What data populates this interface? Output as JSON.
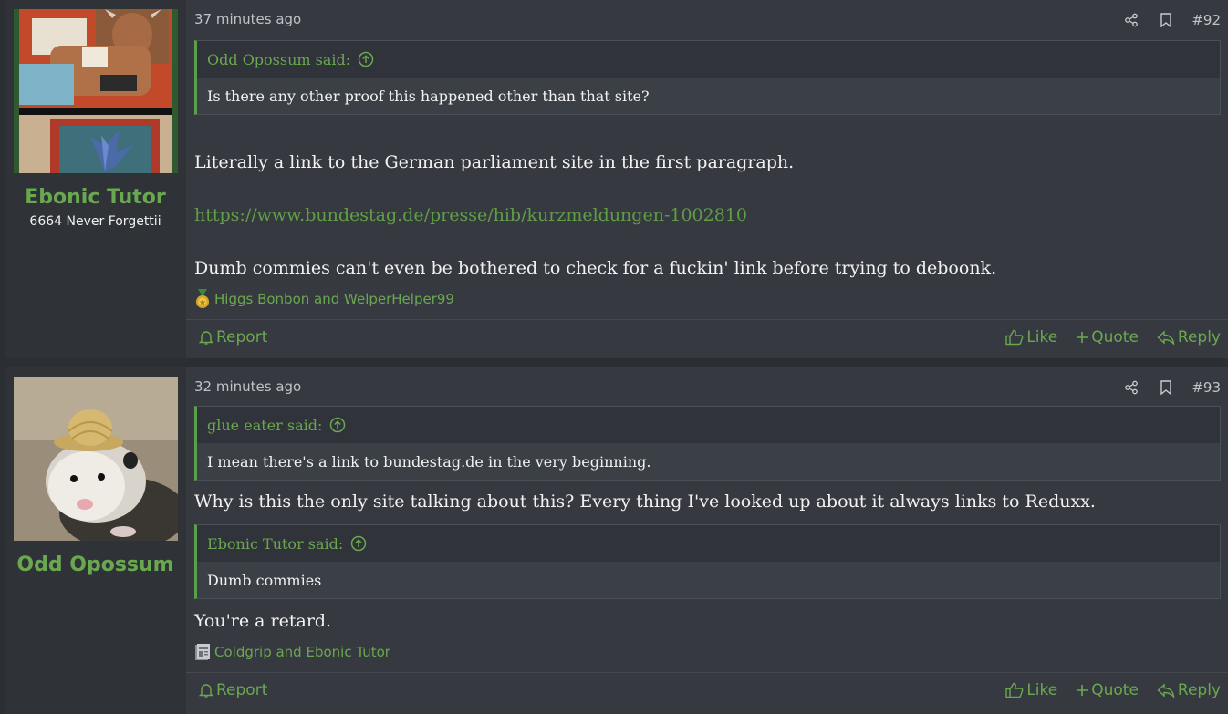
{
  "posts": [
    {
      "username": "Ebonic Tutor",
      "user_title": "6664 Never Forgettii",
      "avatar_icon": "card-art-avatar",
      "time": "37 minutes ago",
      "post_number": "#92",
      "quotes": [
        {
          "author_said": "Odd Opossum said:",
          "text": "Is there any other proof this happened other than that site?"
        }
      ],
      "paragraphs": [
        "Literally a link to the German parliament site in the first paragraph.",
        "https://www.bundestag.de/presse/hib/kurzmeldungen-1002810",
        "Dumb commies can't even be bothered to check for a fuckin' link before trying to deboonk."
      ],
      "reactions_icon": "medal-icon",
      "reactions_text": "Higgs Bonbon and WelperHelper99"
    },
    {
      "username": "Odd Opossum",
      "avatar_icon": "opossum-photo-avatar",
      "time": "32 minutes ago",
      "post_number": "#93",
      "quotes": [
        {
          "author_said": "glue eater said:",
          "text": "I mean there's a link to bundestag.de in the very beginning."
        },
        {
          "author_said": "Ebonic Tutor said:",
          "text": "Dumb commies"
        }
      ],
      "paragraphs": [
        "Why is this the only site talking about this? Every thing I've looked up about it always links to Reduxx.",
        "You're a retard."
      ],
      "reactions_icon": "newspaper-icon",
      "reactions_text": "Coldgrip and Ebonic Tutor"
    }
  ],
  "actions": {
    "report": "Report",
    "like": "Like",
    "quote": "Quote",
    "reply": "Reply"
  },
  "colors": {
    "accent_green": "#6aa84f",
    "post_bg": "#363940",
    "user_cell_bg": "#2f3237"
  }
}
